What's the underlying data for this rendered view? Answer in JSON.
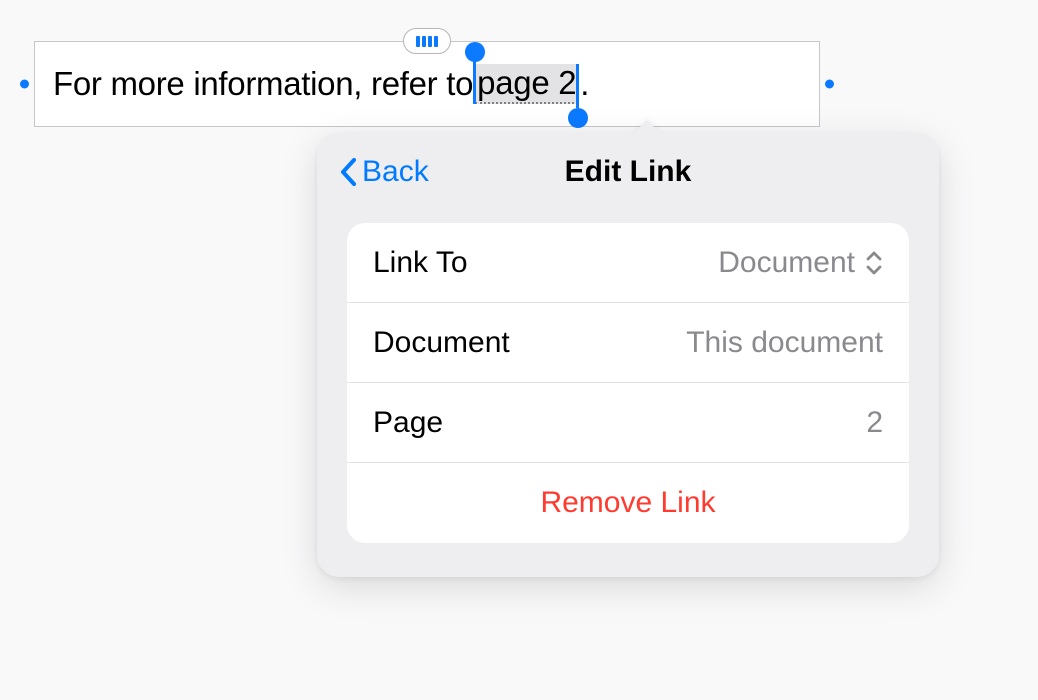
{
  "textbox": {
    "content_before": "For more information, refer to ",
    "linked_text": "page 2",
    "content_after": "."
  },
  "popover": {
    "back_label": "Back",
    "title": "Edit Link",
    "rows": {
      "link_to": {
        "label": "Link To",
        "value": "Document"
      },
      "document": {
        "label": "Document",
        "value": "This document"
      },
      "page": {
        "label": "Page",
        "value": "2"
      }
    },
    "remove_label": "Remove Link"
  }
}
